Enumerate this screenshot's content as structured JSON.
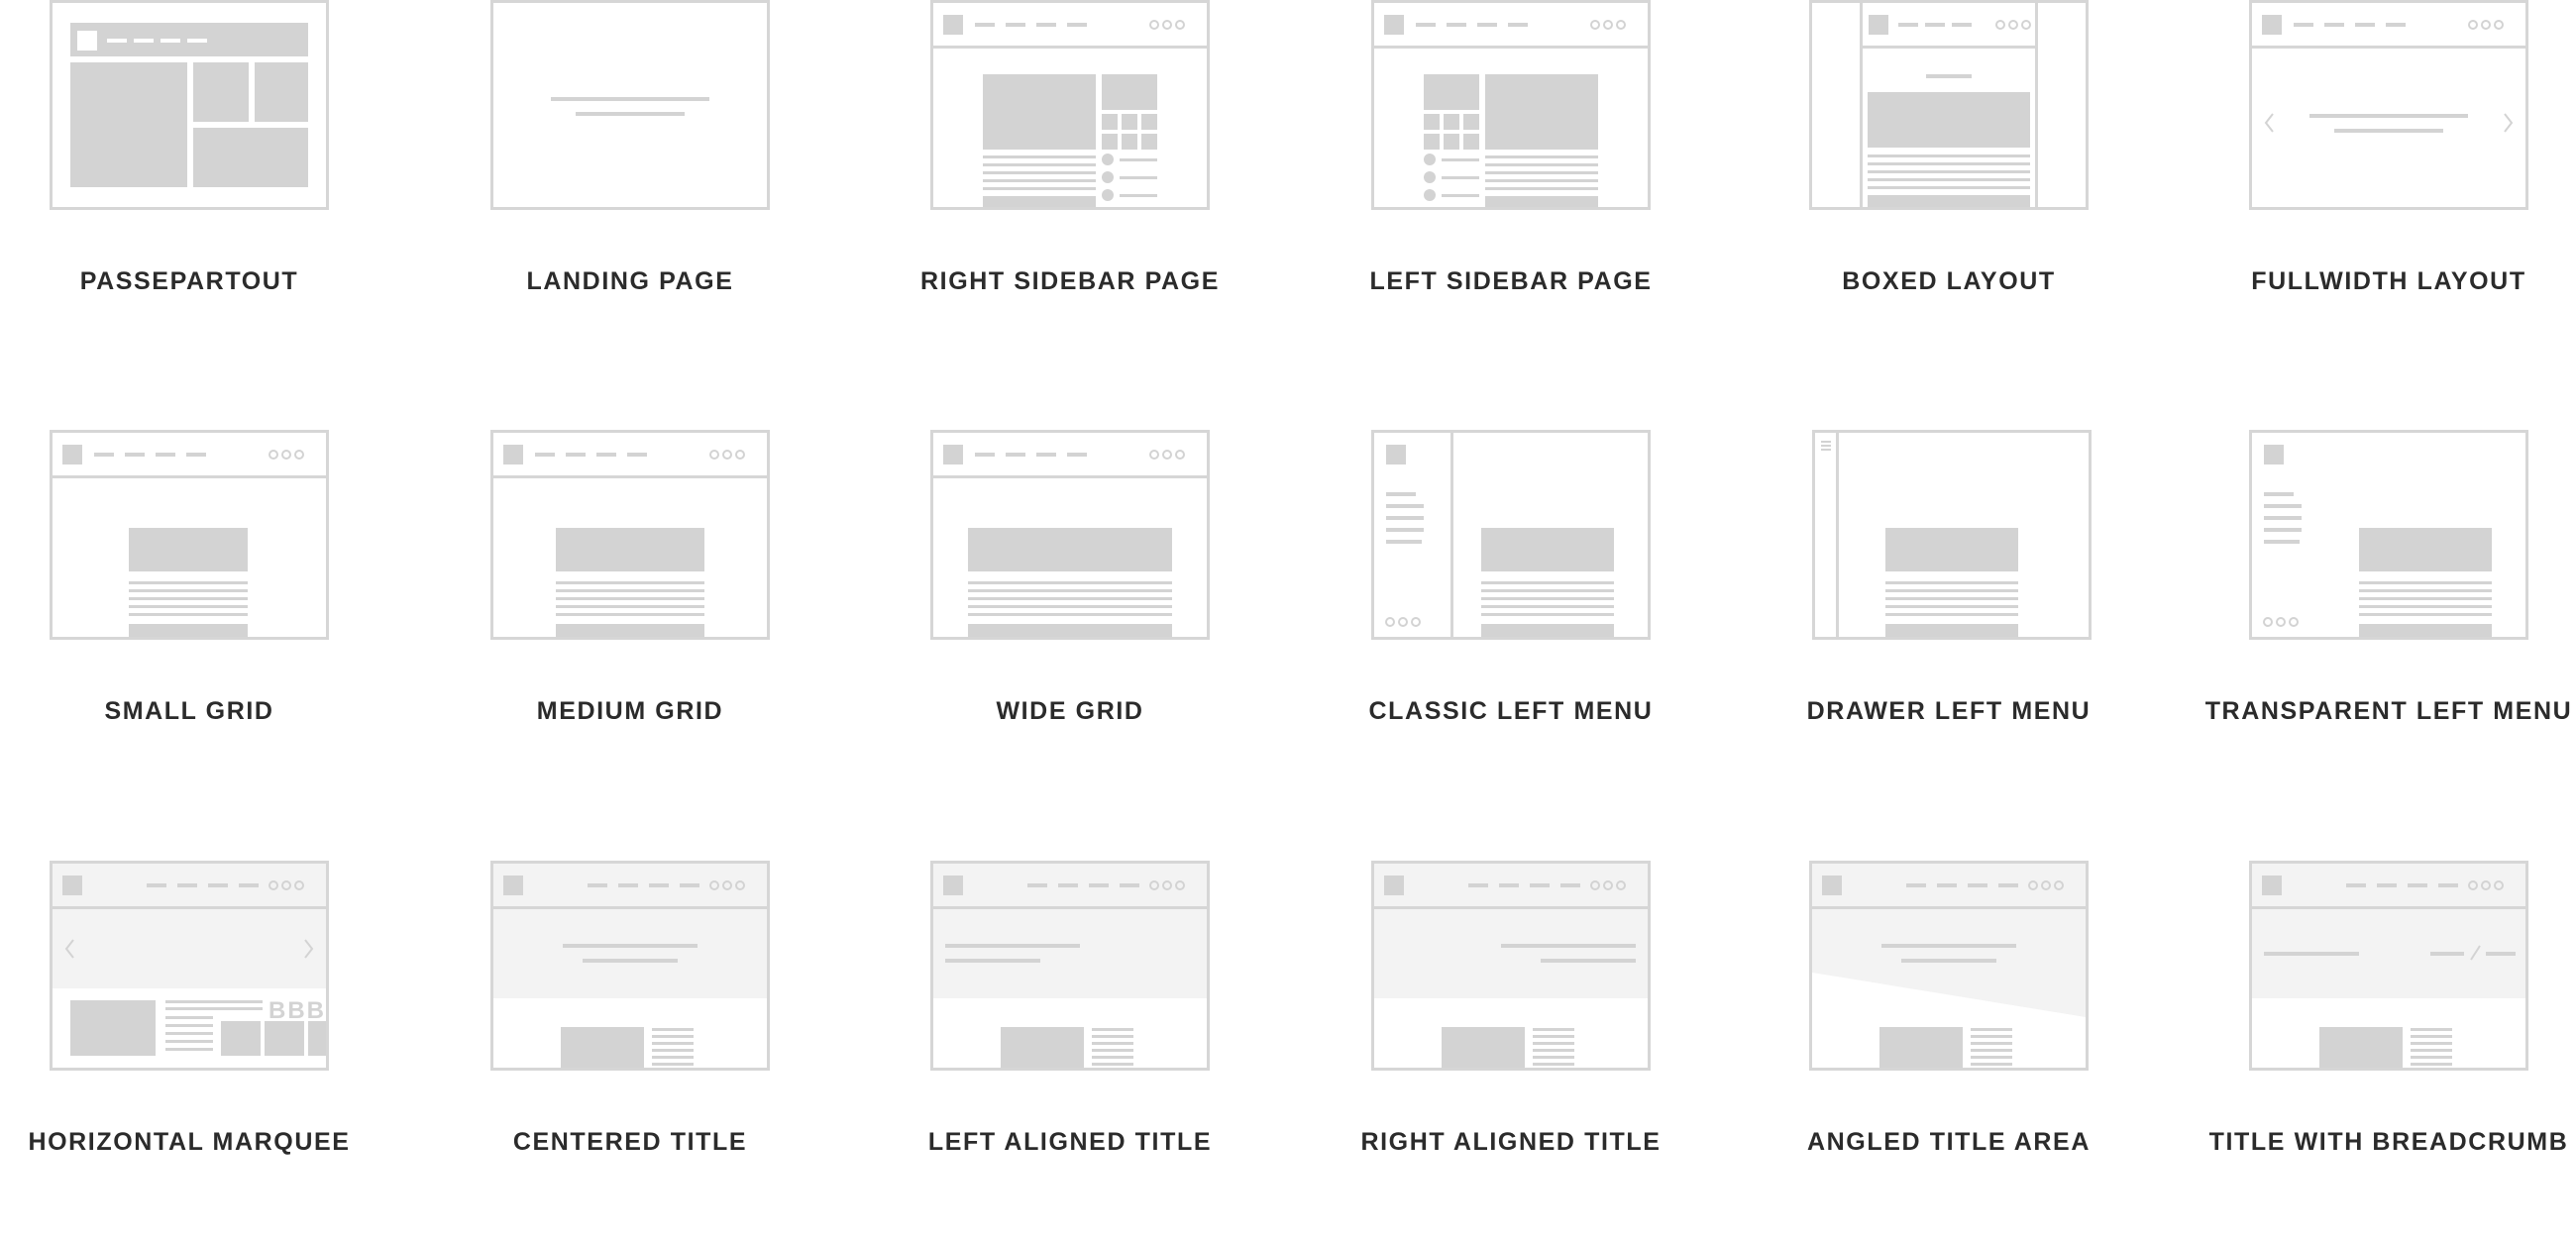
{
  "colors": {
    "stroke": "#d6d6d6",
    "fill": "#d3d3d3",
    "light_band": "#f3f3f3",
    "label": "#2b2b2b"
  },
  "layouts": [
    {
      "id": "passepartout",
      "label": "PASSEPARTOUT"
    },
    {
      "id": "landing-page",
      "label": "LANDING PAGE"
    },
    {
      "id": "right-sidebar-page",
      "label": "RIGHT SIDEBAR PAGE"
    },
    {
      "id": "left-sidebar-page",
      "label": "LEFT SIDEBAR PAGE"
    },
    {
      "id": "boxed-layout",
      "label": "BOXED LAYOUT"
    },
    {
      "id": "fullwidth-layout",
      "label": "FULLWIDTH LAYOUT"
    },
    {
      "id": "small-grid",
      "label": "SMALL GRID"
    },
    {
      "id": "medium-grid",
      "label": "MEDIUM GRID"
    },
    {
      "id": "wide-grid",
      "label": "WIDE GRID"
    },
    {
      "id": "classic-left-menu",
      "label": "CLASSIC LEFT MENU"
    },
    {
      "id": "drawer-left-menu",
      "label": "DRAWER LEFT MENU"
    },
    {
      "id": "transparent-left-menu",
      "label": "TRANSPARENT LEFT MENU"
    },
    {
      "id": "horizontal-marquee",
      "label": "HORIZONTAL MARQUEE",
      "marquee_text": "BBB"
    },
    {
      "id": "centered-title",
      "label": "CENTERED TITLE"
    },
    {
      "id": "left-aligned-title",
      "label": "LEFT ALIGNED TITLE"
    },
    {
      "id": "right-aligned-title",
      "label": "RIGHT ALIGNED TITLE"
    },
    {
      "id": "angled-title-area",
      "label": "ANGLED TITLE AREA"
    },
    {
      "id": "title-with-breadcrumb",
      "label": "TITLE WITH BREADCRUMB"
    }
  ]
}
